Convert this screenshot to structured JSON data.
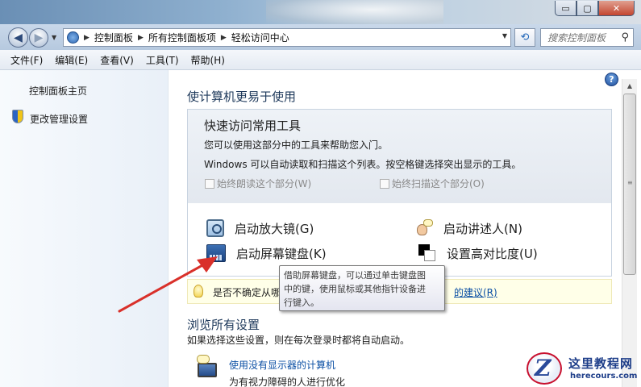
{
  "window": {
    "minimize_label": "▭",
    "maximize_label": "▢",
    "close_label": "✕"
  },
  "address": {
    "crumbs": [
      "控制面板",
      "所有控制面板项",
      "轻松访问中心"
    ],
    "search_placeholder": "搜索控制面板"
  },
  "menu": [
    "文件(F)",
    "编辑(E)",
    "查看(V)",
    "工具(T)",
    "帮助(H)"
  ],
  "sidebar": {
    "home_link": "控制面板主页",
    "manage_link": "更改管理设置"
  },
  "page_title": "使计算机更易于使用",
  "quick_access": {
    "title": "快速访问常用工具",
    "desc1": "您可以使用这部分中的工具来帮助您入门。",
    "desc2": "Windows 可以自动读取和扫描这个列表。按空格键选择突出显示的工具。",
    "check_read": "始终朗读这个部分(W)",
    "check_scan": "始终扫描这个部分(O)",
    "tool_magnifier": "启动放大镜(G)",
    "tool_narrator": "启动讲述人(N)",
    "tool_keyboard": "启动屏幕键盘(K)",
    "tool_contrast": "设置高对比度(U)"
  },
  "suggestion": {
    "text": "是否不确定从哪",
    "link": "的建议(R)"
  },
  "tooltip": {
    "line1": "借助屏幕键盘，可以通过单击键盘图",
    "line2": "中的键，使用鼠标或其他指针设备进",
    "line3": "行键入。"
  },
  "browse": {
    "title": "浏览所有设置",
    "desc": "如果选择这些设置，则在每次登录时都将自动启动。",
    "item_link": "使用没有显示器的计算机",
    "item_sub": "为有视力障碍的人进行优化"
  },
  "watermark": {
    "name": "这里教程网",
    "url": "herecours.com"
  },
  "colors": {
    "arrow": "#d9302a",
    "link": "#0b4fa4",
    "heading": "#1e395b"
  }
}
